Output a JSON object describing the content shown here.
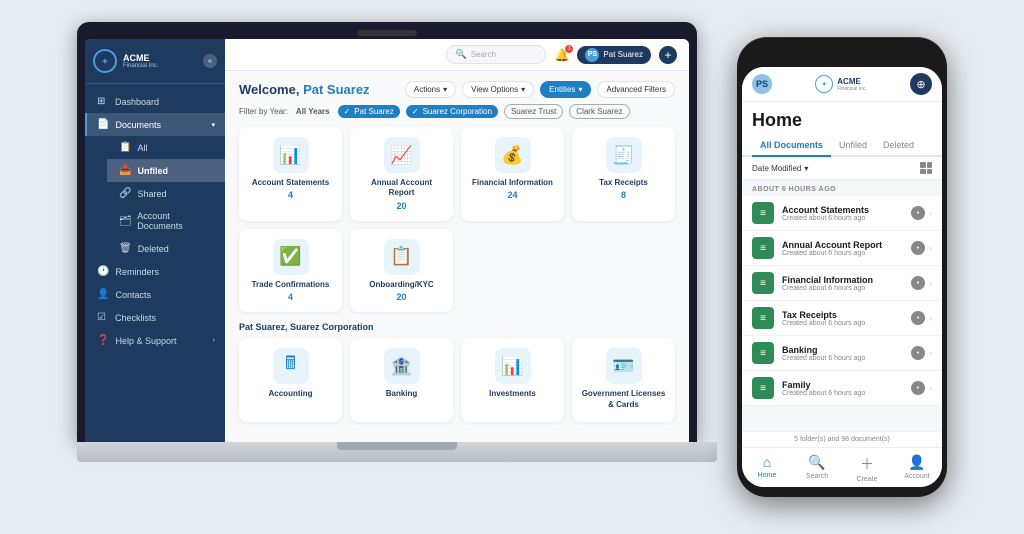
{
  "laptop": {
    "topbar": {
      "search_placeholder": "Search",
      "user_initials": "PS",
      "user_name": "Pat Suarez"
    },
    "sidebar": {
      "logo_text": "ACME",
      "logo_sub": "Financial Inc.",
      "items": [
        {
          "label": "Dashboard",
          "icon": "⊞"
        },
        {
          "label": "Documents",
          "icon": "📄",
          "has_children": true
        },
        {
          "label": "All",
          "icon": "📋",
          "is_sub": true
        },
        {
          "label": "Unfiled",
          "icon": "📥",
          "is_sub": true,
          "active": true
        },
        {
          "label": "Shared",
          "icon": "🔗",
          "is_sub": true
        },
        {
          "label": "Account Documents",
          "icon": "🗂",
          "is_sub": true
        },
        {
          "label": "Deleted",
          "icon": "🗑",
          "is_sub": true
        },
        {
          "label": "Reminders",
          "icon": "🕐"
        },
        {
          "label": "Contacts",
          "icon": "👤"
        },
        {
          "label": "Checklists",
          "icon": "☑"
        },
        {
          "label": "Help & Support",
          "icon": "?",
          "has_arrow": true
        }
      ]
    },
    "page": {
      "welcome": "Welcome,",
      "user_name": "Pat Suarez",
      "actions_label": "Actions",
      "view_options_label": "View Options",
      "entities_label": "Entities",
      "advanced_filters_label": "Advanced Filters",
      "filter_label": "Filter by Year:",
      "filter_value": "All Years",
      "filters": [
        {
          "label": "Pat Suarez",
          "checked": true
        },
        {
          "label": "Suarez Corporation",
          "checked": true
        },
        {
          "label": "Suarez Trust",
          "checked": false
        },
        {
          "label": "Clark Suarez",
          "checked": false
        }
      ],
      "section1_title": "Pat Suarez",
      "doc_cards_1": [
        {
          "name": "Account Statements",
          "count": "4",
          "icon": "📊"
        },
        {
          "name": "Annual Account Report",
          "count": "20",
          "icon": "📈"
        },
        {
          "name": "Financial Information",
          "count": "24",
          "icon": "💰"
        },
        {
          "name": "Tax Receipts",
          "count": "8",
          "icon": "🧾"
        },
        {
          "name": "Trade Confirmations",
          "count": "4",
          "icon": "✅"
        },
        {
          "name": "Onboarding/KYC",
          "count": "20",
          "icon": "📋"
        }
      ],
      "section2_title": "Pat Suarez, Suarez Corporation",
      "doc_cards_2": [
        {
          "name": "Accounting",
          "count": "",
          "icon": "🖩"
        },
        {
          "name": "Banking",
          "count": "",
          "icon": "🏦"
        },
        {
          "name": "Investments",
          "count": "",
          "icon": "📊"
        },
        {
          "name": "Government Licenses & Cards",
          "count": "",
          "icon": "🪪"
        }
      ]
    }
  },
  "mobile": {
    "user_initials": "PS",
    "logo_text": "ACME",
    "logo_sub": "Financial Inc.",
    "page_title": "Home",
    "tabs": [
      {
        "label": "All Documents",
        "active": true
      },
      {
        "label": "Unfiled",
        "active": false
      },
      {
        "label": "Deleted",
        "active": false
      }
    ],
    "filter_label": "Date Modified",
    "section_label": "ABOUT 6 HOURS AGO",
    "list_items": [
      {
        "name": "Account Statements",
        "sub": "Created about 6 hours ago"
      },
      {
        "name": "Annual Account Report",
        "sub": "Created about 6 hours ago"
      },
      {
        "name": "Financial Information",
        "sub": "Created about 6 hours ago"
      },
      {
        "name": "Tax Receipts",
        "sub": "Created about 6 hours ago"
      },
      {
        "name": "Banking",
        "sub": "Created about 6 hours ago"
      },
      {
        "name": "Family",
        "sub": "Created about 6 hours ago"
      }
    ],
    "footer_text": "5 folder(s) and 98 document(s)",
    "nav_items": [
      {
        "label": "Home",
        "icon": "⌂",
        "active": true
      },
      {
        "label": "Search",
        "icon": "🔍",
        "active": false
      },
      {
        "label": "Create",
        "icon": "＋",
        "active": false
      },
      {
        "label": "Account",
        "icon": "👤",
        "active": false
      }
    ]
  }
}
